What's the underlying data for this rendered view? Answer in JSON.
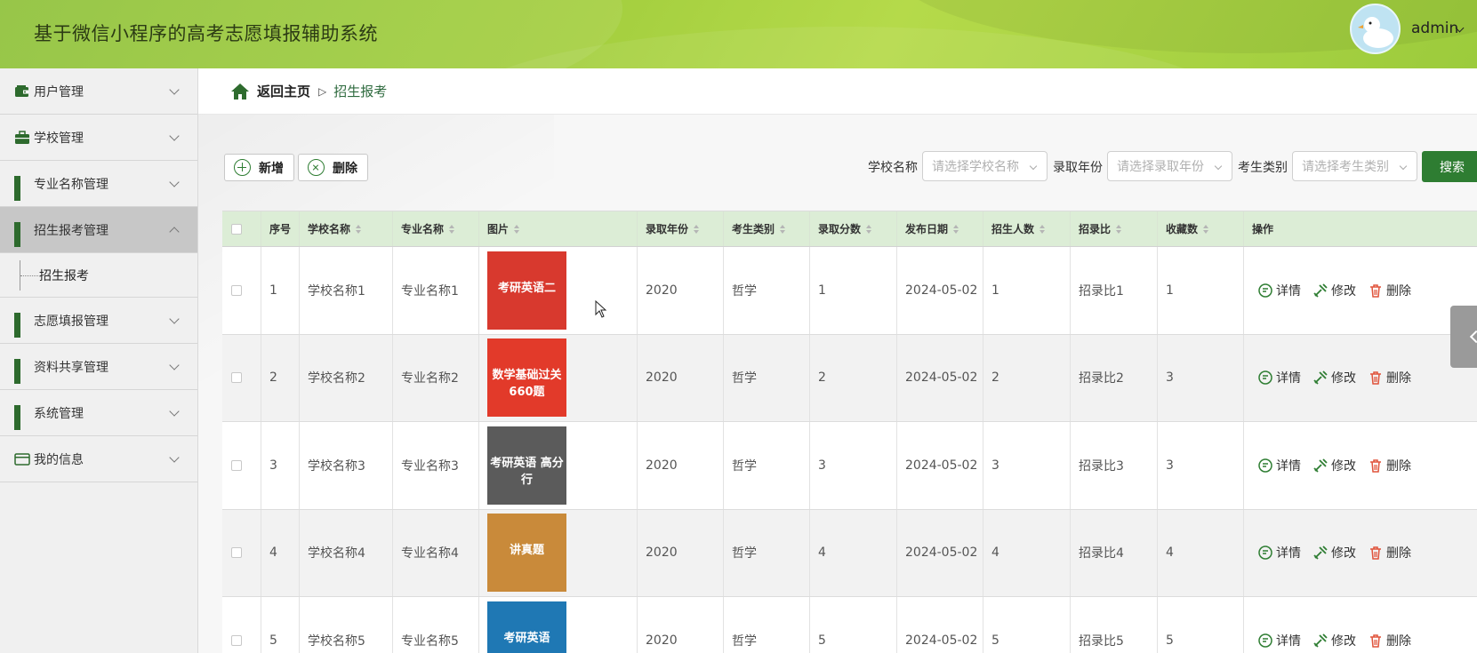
{
  "header": {
    "title": "基于微信小程序的高考志愿填报辅助系统",
    "user": "admin",
    "colors": {
      "primary": "#2e7d32",
      "header_bg": "#a4cf3f"
    }
  },
  "sidebar": {
    "items": [
      {
        "label": "用户管理",
        "icon": "wallet-icon"
      },
      {
        "label": "学校管理",
        "icon": "briefcase-icon"
      },
      {
        "label": "专业名称管理",
        "icon": "grid-icon"
      },
      {
        "label": "招生报考管理",
        "icon": "grid-icon",
        "expanded": true,
        "sub": [
          {
            "label": "招生报考"
          }
        ]
      },
      {
        "label": "志愿填报管理",
        "icon": "grid-icon"
      },
      {
        "label": "资料共享管理",
        "icon": "grid-icon"
      },
      {
        "label": "系统管理",
        "icon": "grid-icon"
      },
      {
        "label": "我的信息",
        "icon": "id-card-icon"
      }
    ]
  },
  "breadcrumb": {
    "home": "返回主页",
    "separator": "▷",
    "current": "招生报考"
  },
  "toolbar": {
    "add_label": "新增",
    "delete_label": "删除"
  },
  "filters": {
    "school": {
      "label": "学校名称",
      "placeholder": "请选择学校名称"
    },
    "year": {
      "label": "录取年份",
      "placeholder": "请选择录取年份"
    },
    "category": {
      "label": "考生类别",
      "placeholder": "请选择考生类别"
    },
    "search_label": "搜索"
  },
  "table": {
    "columns": [
      "序号",
      "学校名称",
      "专业名称",
      "图片",
      "录取年份",
      "考生类别",
      "录取分数",
      "发布日期",
      "招生人数",
      "招录比",
      "收藏数",
      "操作"
    ],
    "actions": {
      "detail": "详情",
      "edit": "修改",
      "delete": "删除"
    },
    "rows": [
      {
        "no": "1",
        "school": "学校名称1",
        "major": "专业名称1",
        "year": "2020",
        "category": "哲学",
        "score": "1",
        "date": "2024-05-02",
        "count": "1",
        "ratio": "招录比1",
        "favorites": "1"
      },
      {
        "no": "2",
        "school": "学校名称2",
        "major": "专业名称2",
        "year": "2020",
        "category": "哲学",
        "score": "2",
        "date": "2024-05-02",
        "count": "2",
        "ratio": "招录比2",
        "favorites": "3"
      },
      {
        "no": "3",
        "school": "学校名称3",
        "major": "专业名称3",
        "year": "2020",
        "category": "哲学",
        "score": "3",
        "date": "2024-05-02",
        "count": "3",
        "ratio": "招录比3",
        "favorites": "3"
      },
      {
        "no": "4",
        "school": "学校名称4",
        "major": "专业名称4",
        "year": "2020",
        "category": "哲学",
        "score": "4",
        "date": "2024-05-02",
        "count": "4",
        "ratio": "招录比4",
        "favorites": "4"
      },
      {
        "no": "5",
        "school": "学校名称5",
        "major": "专业名称5",
        "year": "2020",
        "category": "哲学",
        "score": "5",
        "date": "2024-05-02",
        "count": "5",
        "ratio": "招录比5",
        "favorites": "5"
      }
    ],
    "thumbnails": [
      {
        "title": "考研英语二",
        "bg": "#d8392e"
      },
      {
        "title": "数学基础过关660题",
        "bg": "#e23a2a"
      },
      {
        "title": "考研英语 高分行",
        "bg": "#5b5b5b"
      },
      {
        "title": "讲真题",
        "bg": "#c98a3a"
      },
      {
        "title": "考研英语",
        "bg": "#1f78b4"
      }
    ]
  }
}
